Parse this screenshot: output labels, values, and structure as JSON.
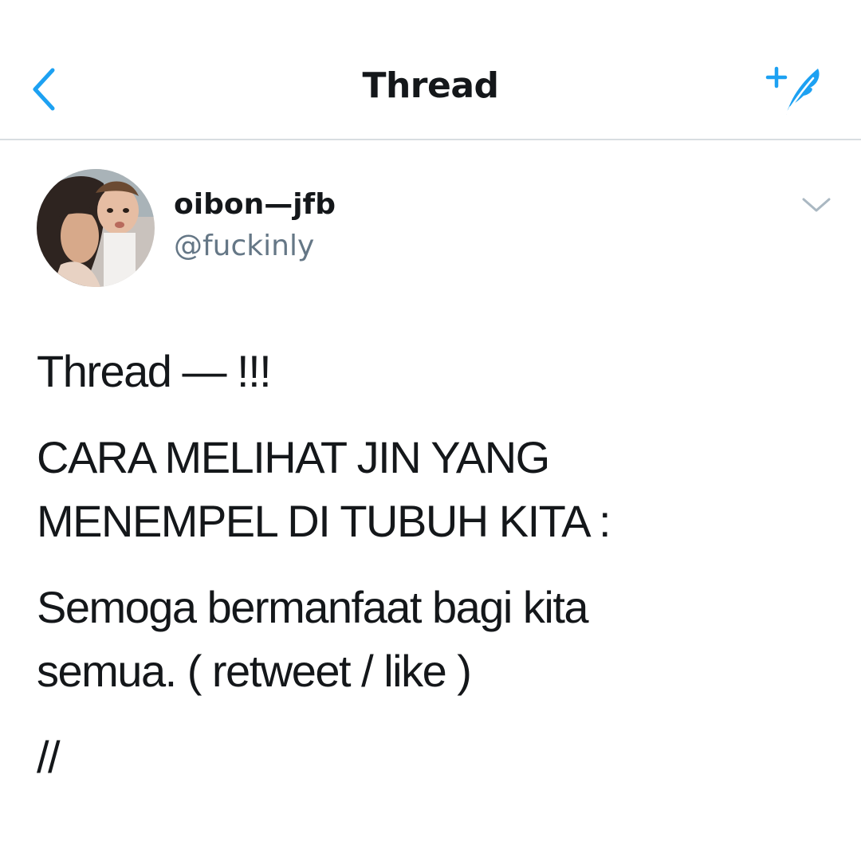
{
  "nav": {
    "title": "Thread",
    "back_icon": "chevron-left-icon",
    "compose_icon": "compose-tweet-icon",
    "accent_color": "#1da1f2"
  },
  "tweet": {
    "author": {
      "display_name": "oibon—jfb",
      "handle": "@fuckinly"
    },
    "more_icon": "chevron-down-icon",
    "paragraphs": [
      "Thread — !!!",
      "CARA MELIHAT JIN YANG\nMENEMPEL DI TUBUH KITA :",
      "Semoga bermanfaat bagi kita\nsemua. ( retweet / like )",
      "//"
    ]
  }
}
